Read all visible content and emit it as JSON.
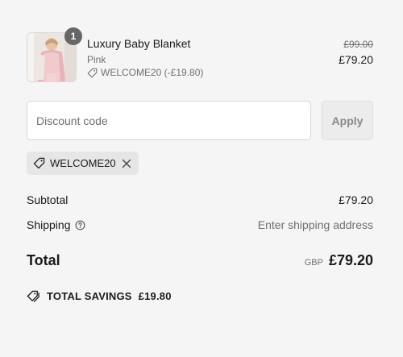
{
  "product": {
    "title": "Luxury Baby Blanket",
    "variant": "Pink",
    "discount_line": "WELCOME20 (-£19.80)",
    "quantity": "1",
    "original_price": "£99.00",
    "price": "£79.20",
    "image_icon": "product-image-icon"
  },
  "discount": {
    "placeholder": "Discount code",
    "apply_label": "Apply",
    "applied_code": "WELCOME20",
    "remove_icon": "close-icon",
    "tag_icon": "tag-icon"
  },
  "summary": {
    "subtotal_label": "Subtotal",
    "subtotal_value": "£79.20",
    "shipping_label": "Shipping",
    "shipping_value": "Enter shipping address",
    "total_label": "Total",
    "total_currency": "GBP",
    "total_value": "£79.20",
    "help_icon": "question-circle-icon"
  },
  "savings": {
    "label": "TOTAL SAVINGS",
    "value": "£19.80",
    "icon": "tags-icon"
  },
  "colors": {
    "background": "#f5f5f5",
    "badge": "#666666",
    "muted_text": "#707070",
    "tag_bg": "#e6e6e6"
  }
}
